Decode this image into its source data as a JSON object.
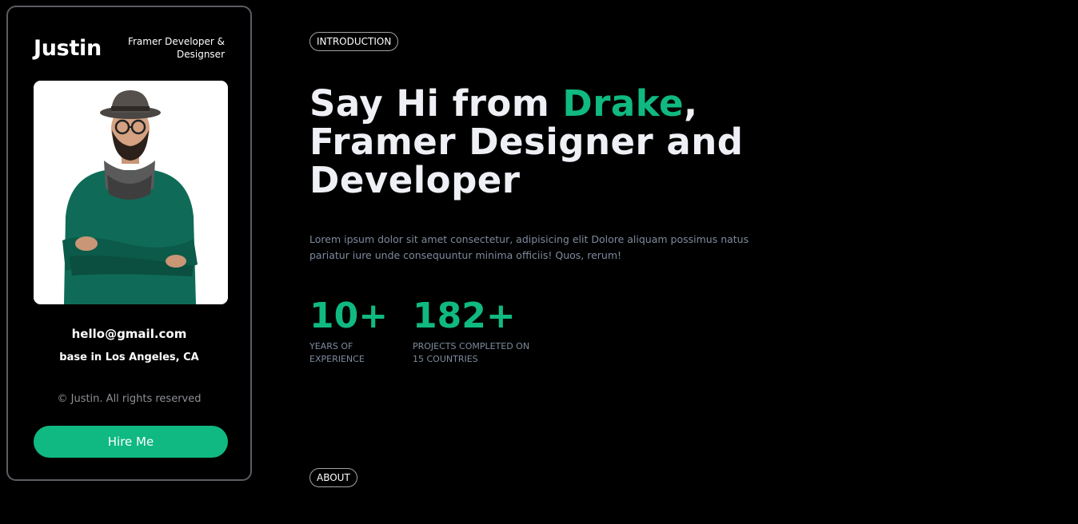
{
  "profile": {
    "name": "Justin",
    "role_line1": "Framer Developer &",
    "role_line2": "Designser",
    "email": "hello@gmail.com",
    "base": "base in Los Angeles, CA",
    "copyright": "© Justin. All rights reserved",
    "hire_label": "Hire Me"
  },
  "intro": {
    "pill_label": "INTRODUCTION",
    "headline_part1": "Say Hi from ",
    "headline_accent": "Drake",
    "headline_part2": ",",
    "headline_line2": "Framer Designer and",
    "headline_line3": "Developer",
    "description_line1": "Lorem ipsum dolor sit amet consectetur, adipisicing elit Dolore aliquam possimus natus",
    "description_line2": "pariatur iure unde consequuntur minima officiis! Quos, rerum!"
  },
  "stats": [
    {
      "value": "10+",
      "label_line1": "YEARS OF",
      "label_line2": "EXPERIENCE"
    },
    {
      "value": "182+",
      "label_line1": "PROJECTS COMPLETED ON",
      "label_line2": "15 COUNTRIES"
    }
  ],
  "about": {
    "pill_label": "ABOUT"
  },
  "colors": {
    "accent": "#10b981",
    "background": "#000000",
    "muted_text": "#7d8b9d",
    "card_border": "#5a5d63"
  }
}
